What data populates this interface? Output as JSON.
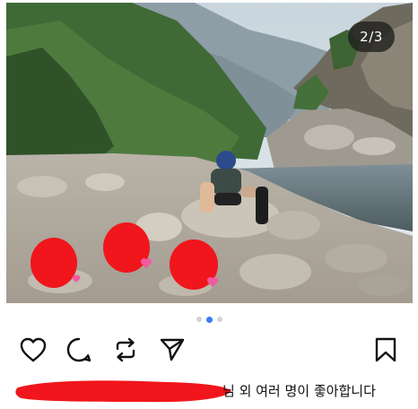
{
  "carousel": {
    "counter": "2/3",
    "dot_count": 3,
    "active_index": 1,
    "accent_color": "#3b7cf5"
  },
  "actions": {
    "like_icon": "heart-icon",
    "comment_icon": "comment-icon",
    "repost_icon": "repost-icon",
    "share_icon": "send-icon",
    "save_icon": "bookmark-icon"
  },
  "likes": {
    "text": "님 외 여러 명이 좋아합니다",
    "redaction_color": "#f0161c"
  }
}
